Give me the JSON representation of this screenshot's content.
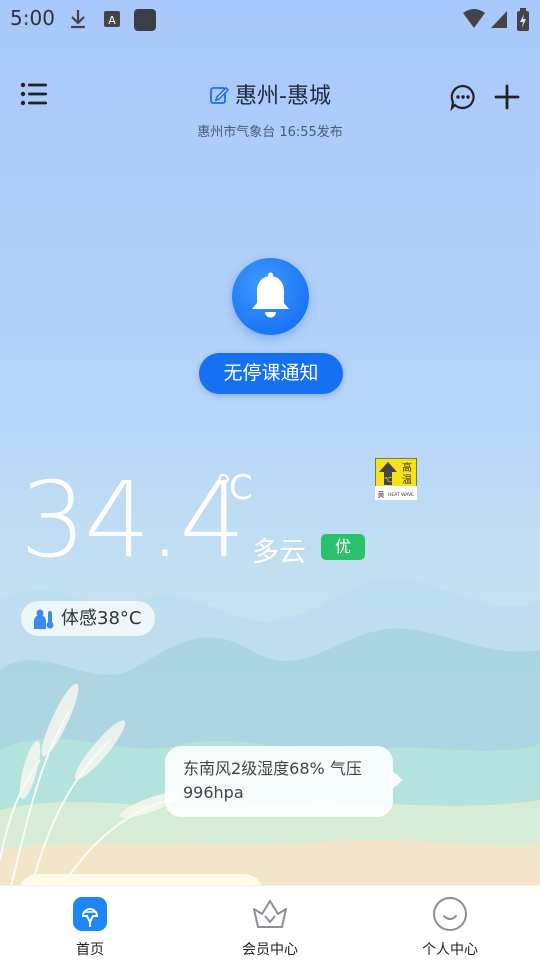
{
  "status_bar": {
    "time": "5:00"
  },
  "header": {
    "city": "惠州-惠城",
    "update_info": "惠州市气象台 16:55发布"
  },
  "notice": {
    "label": "无停课通知"
  },
  "weather": {
    "temperature": "34.4",
    "unit": "℃",
    "condition": "多云",
    "aqi": "优",
    "feels_like": "体感38°C",
    "warning": {
      "line1": "高",
      "line2": "温",
      "level": "黄",
      "text": "HEAT WAVE",
      "color": "#f5e11c"
    },
    "details": "东南风2级湿度68% 气压996hpa"
  },
  "nav": {
    "items": [
      {
        "label": "首页",
        "icon": "home-icon",
        "active": true
      },
      {
        "label": "会员中心",
        "icon": "crown-icon",
        "active": false
      },
      {
        "label": "个人中心",
        "icon": "smile-icon",
        "active": false
      }
    ]
  },
  "colors": {
    "accent": "#1571f2",
    "aqi_good": "#2bc06b"
  }
}
